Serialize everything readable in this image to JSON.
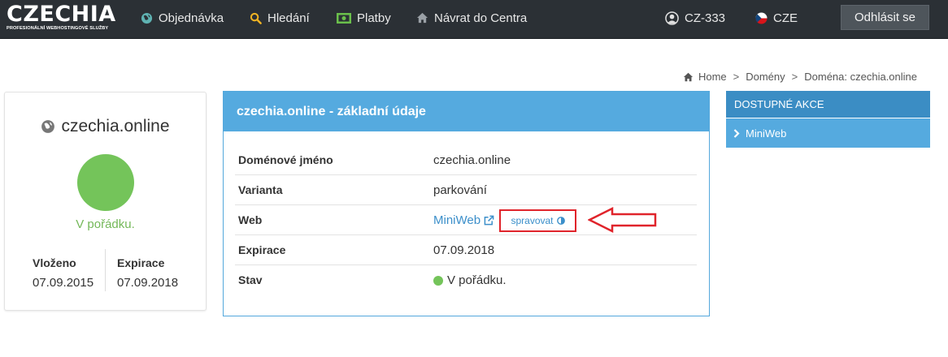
{
  "brand": {
    "name": "CZECHIA",
    "tagline": "PROFESIONÁLNÍ WEBHOSTINGOVÉ SLUŽBY"
  },
  "nav": {
    "objednavka": "Objednávka",
    "hledani": "Hledání",
    "platby": "Platby",
    "navrat": "Návrat do Centra",
    "account": "CZ-333",
    "language": "CZE",
    "logout": "Odhlásit se"
  },
  "breadcrumb": {
    "home": "Home",
    "domeny": "Domény",
    "current": "Doména: czechia.online"
  },
  "domain_card": {
    "name": "czechia.online",
    "status": "V pořádku.",
    "inserted_label": "Vloženo",
    "inserted_value": "07.09.2015",
    "expiry_label": "Expirace",
    "expiry_value": "07.09.2018"
  },
  "details": {
    "heading": "czechia.online - základní údaje",
    "rows": [
      {
        "label": "Doménové jméno",
        "value": "czechia.online"
      },
      {
        "label": "Varianta",
        "value": "parkování"
      },
      {
        "label": "Web",
        "value": "MiniWeb",
        "action": "spravovat"
      },
      {
        "label": "Expirace",
        "value": "07.09.2018"
      },
      {
        "label": "Stav",
        "value": "V pořádku."
      }
    ]
  },
  "actions": {
    "heading": "DOSTUPNÉ AKCE",
    "items": [
      {
        "label": "MiniWeb"
      }
    ]
  },
  "colors": {
    "navbar": "#2b3035",
    "primary": "#55aadf",
    "primary_dark": "#3b8dc4",
    "success": "#74c45a",
    "link": "#3c8fca",
    "annotation": "#e0242b"
  },
  "icons": {
    "objednavka": "globe-icon",
    "hledani": "search-icon",
    "platby": "money-icon",
    "navrat": "home-icon",
    "account": "user-icon",
    "language": "czech-flag-icon"
  }
}
